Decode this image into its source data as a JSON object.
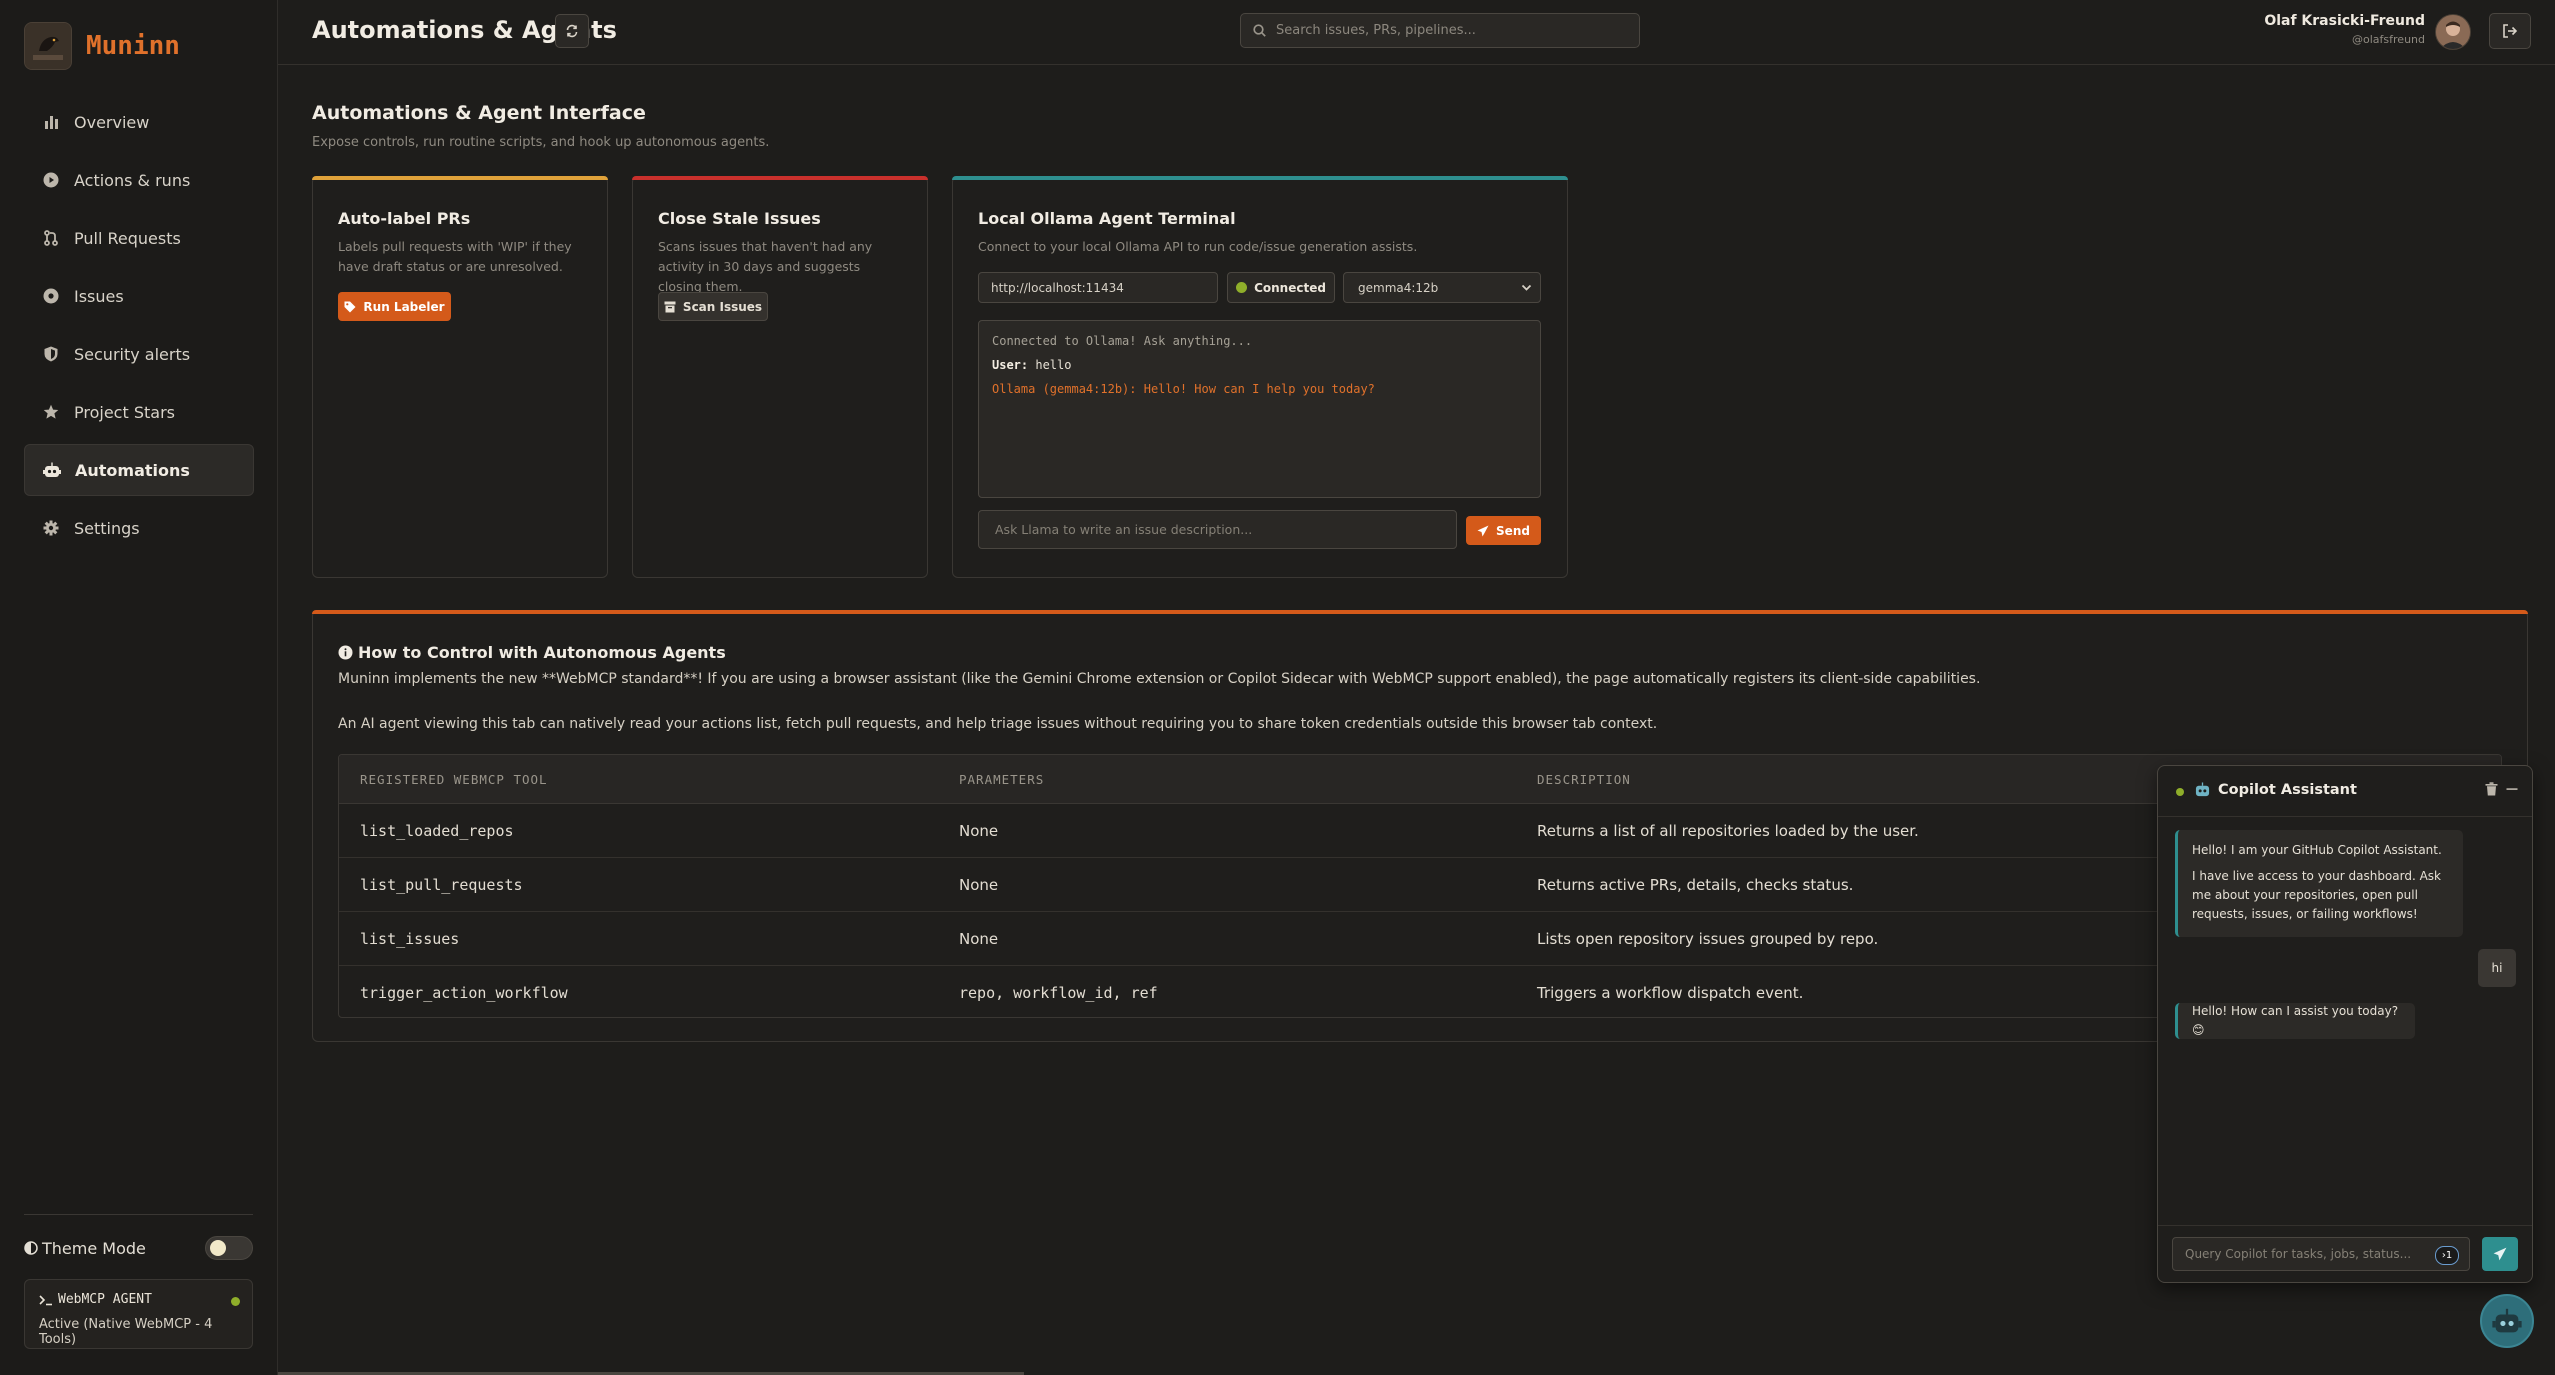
{
  "brand": {
    "name": "Muninn",
    "logo_text": "MUNINN"
  },
  "sidebar": {
    "items": [
      {
        "label": "Overview",
        "icon": "bar-chart-icon",
        "active": false
      },
      {
        "label": "Actions & runs",
        "icon": "play-circle-icon",
        "active": false
      },
      {
        "label": "Pull Requests",
        "icon": "pull-request-icon",
        "active": false
      },
      {
        "label": "Issues",
        "icon": "issue-dot-icon",
        "active": false
      },
      {
        "label": "Security alerts",
        "icon": "shield-icon",
        "active": false
      },
      {
        "label": "Project Stars",
        "icon": "star-icon",
        "active": false
      },
      {
        "label": "Automations",
        "icon": "robot-icon",
        "active": true
      },
      {
        "label": "Settings",
        "icon": "gear-icon",
        "active": false
      }
    ],
    "theme_label": "Theme Mode",
    "agent": {
      "title": "WebMCP AGENT",
      "status": "Active (Native WebMCP - 4 Tools)"
    }
  },
  "header": {
    "title": "Automations & Agents",
    "search_placeholder": "Search issues, PRs, pipelines...",
    "user_name": "Olaf Krasicki-Freund",
    "user_handle": "@olafsfreund"
  },
  "main": {
    "section_title": "Automations & Agent Interface",
    "section_subtitle": "Expose controls, run routine scripts, and hook up autonomous agents.",
    "cards": [
      {
        "title": "Auto-label PRs",
        "desc": "Labels pull requests with 'WIP' if they have draft status or are unresolved.",
        "button": "Run Labeler",
        "accent": "#e0a23a"
      },
      {
        "title": "Close Stale Issues",
        "desc": "Scans issues that haven't had any activity in 30 days and suggests closing them.",
        "button": "Scan Issues",
        "accent": "#c9302c"
      }
    ],
    "terminal": {
      "title": "Local Ollama Agent Terminal",
      "desc": "Connect to your local Ollama API to run code/issue generation assists.",
      "url": "http://localhost:11434",
      "status": "Connected",
      "model": "gemma4:12b",
      "accent": "#2e8f8f",
      "log": {
        "system": "Connected to Ollama! Ask anything...",
        "user_prefix": "User:",
        "user_text": "hello",
        "bot_line": "Ollama (gemma4:12b): Hello! How can I help you today?"
      },
      "input_placeholder": "Ask Llama to write an issue description...",
      "send_label": "Send"
    }
  },
  "info": {
    "title": "How to Control with Autonomous Agents",
    "p1": "Muninn implements the new **WebMCP standard**! If you are using a browser assistant (like the Gemini Chrome extension or Copilot Sidecar with WebMCP support enabled), the page automatically registers its client-side capabilities.",
    "p2": "An AI agent viewing this tab can natively read your actions list, fetch pull requests, and help triage issues without requiring you to share token credentials outside this browser tab context.",
    "table": {
      "headers": [
        "REGISTERED WEBMCP TOOL",
        "PARAMETERS",
        "DESCRIPTION"
      ],
      "rows": [
        [
          "list_loaded_repos",
          "None",
          "Returns a list of all repositories loaded by the user."
        ],
        [
          "list_pull_requests",
          "None",
          "Returns active PRs, details, checks status."
        ],
        [
          "list_issues",
          "None",
          "Lists open repository issues grouped by repo."
        ],
        [
          "trigger_action_workflow",
          "repo, workflow_id, ref",
          "Triggers a workflow dispatch event."
        ]
      ]
    }
  },
  "copilot": {
    "title": "Copilot Assistant",
    "msg1_a": "Hello! I am your GitHub Copilot Assistant.",
    "msg1_b": "I have live access to your dashboard. Ask me about your repositories, open pull requests, issues, or failing workflows!",
    "user_msg": "hi",
    "msg2": "Hello! How can I assist you today? 😊",
    "input_placeholder": "Query Copilot for tasks, jobs, status...",
    "kbd_hint": "1"
  }
}
